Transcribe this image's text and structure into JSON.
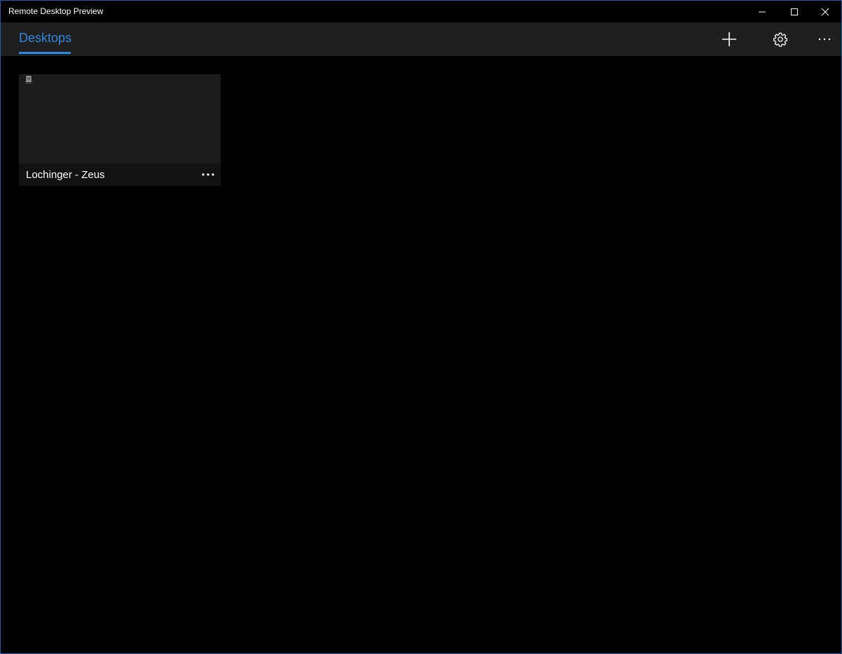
{
  "window": {
    "title": "Remote Desktop Preview",
    "accent_color": "#2f86e0",
    "border_color": "#1f5ca8"
  },
  "caption_buttons": {
    "minimize_icon": "minimize-icon",
    "maximize_icon": "maximize-icon",
    "close_icon": "close-icon"
  },
  "appbar": {
    "tabs": [
      {
        "label": "Desktops",
        "selected": true
      }
    ],
    "actions": [
      {
        "icon": "add-icon"
      },
      {
        "icon": "gear-icon"
      },
      {
        "icon": "more-horizontal-icon"
      }
    ]
  },
  "desktops": [
    {
      "name": "Lochinger - Zeus",
      "thumbnail_icon": "recycle-bin-icon",
      "menu_icon": "more-horizontal-icon"
    }
  ]
}
